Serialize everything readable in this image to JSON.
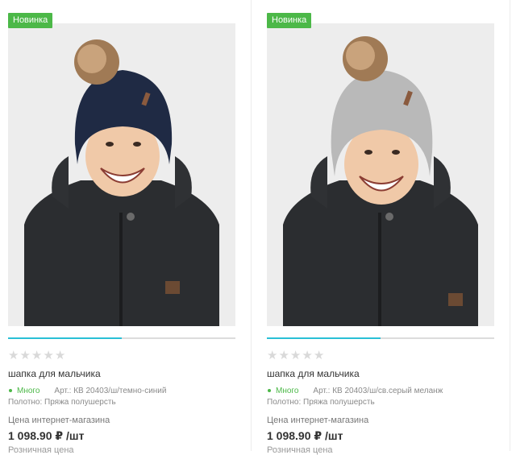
{
  "products": [
    {
      "badge": "Новинка",
      "hat_color": "#1f2a44",
      "rating_stars": 0,
      "title": "шапка для мальчика",
      "stock_label": "Много",
      "article": "Арт.: КВ 20403/ш/темно-синий",
      "material": "Полотно: Пряжа полушерсть",
      "price_label": "Цена интернет-магазина",
      "price": "1 098.90 ₽ /шт",
      "retail_label": "Розничная цена"
    },
    {
      "badge": "Новинка",
      "hat_color": "#b9b9b9",
      "rating_stars": 0,
      "title": "шапка для мальчика",
      "stock_label": "Много",
      "article": "Арт.: КВ 20403/ш/св.серый меланж",
      "material": "Полотно: Пряжа полушерсть",
      "price_label": "Цена интернет-магазина",
      "price": "1 098.90 ₽ /шт",
      "retail_label": "Розничная цена"
    }
  ],
  "colors": {
    "badge": "#4cb848",
    "accent": "#29c0d6",
    "stock": "#4cb848"
  }
}
